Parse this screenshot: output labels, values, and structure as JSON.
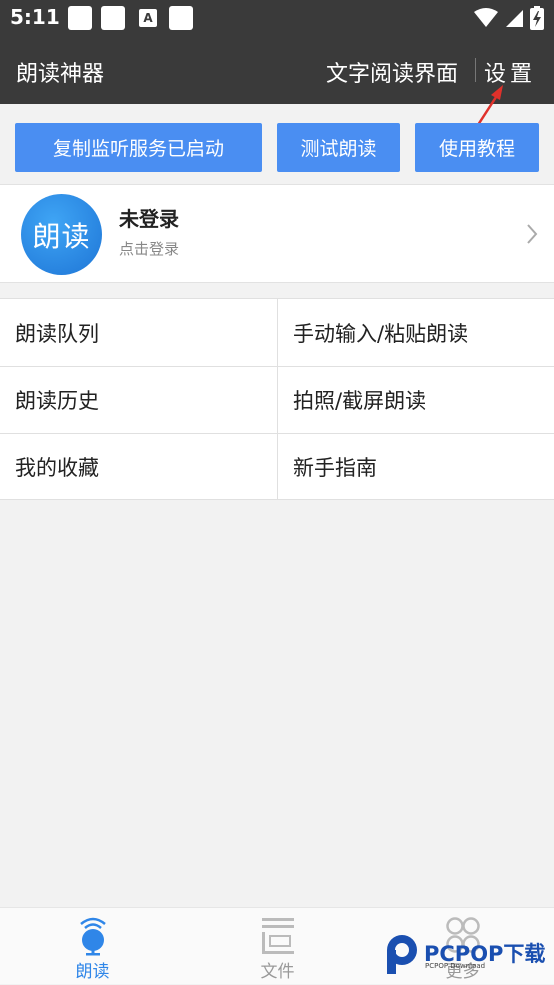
{
  "status_bar": {
    "time": "5:11",
    "notification_a": "A"
  },
  "app_bar": {
    "title": "朗读神器",
    "reader_link": "文字阅读界面",
    "settings": "设置"
  },
  "actions": {
    "monitor_service": "复制监听服务已启动",
    "test_read": "测试朗读",
    "tutorial": "使用教程"
  },
  "login": {
    "avatar_text": "朗读",
    "name": "未登录",
    "hint": "点击登录"
  },
  "menu": [
    {
      "label": "朗读队列"
    },
    {
      "label": "手动输入/粘贴朗读"
    },
    {
      "label": "朗读历史"
    },
    {
      "label": "拍照/截屏朗读"
    },
    {
      "label": "我的收藏"
    },
    {
      "label": "新手指南"
    }
  ],
  "bottom_nav": {
    "items": [
      {
        "label": "朗读",
        "icon": "microphone-icon"
      },
      {
        "label": "文件",
        "icon": "file-icon"
      },
      {
        "label": "更多",
        "icon": "more-icon"
      }
    ],
    "active_index": 0
  },
  "watermark": {
    "brand": "PCPOP下载",
    "sub": "PCPOP Download"
  },
  "colors": {
    "bar": "#3a3a3a",
    "accent": "#4a8ef2",
    "active_nav": "#2f86e8",
    "arrow": "#e0312b"
  }
}
